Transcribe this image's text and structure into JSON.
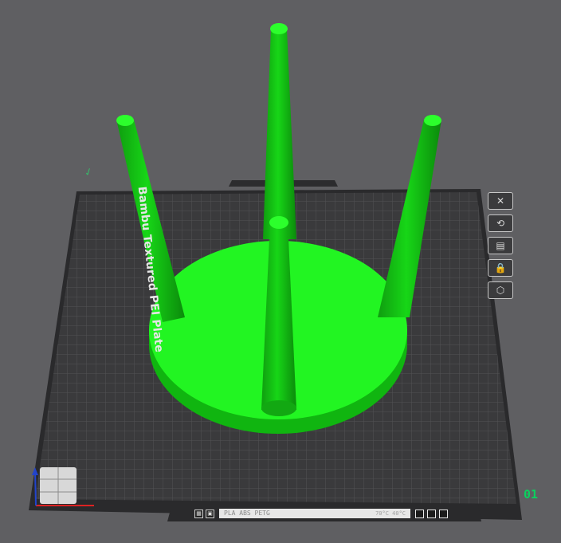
{
  "plate": {
    "name": "Bambu Textured PEI Plate",
    "number": "01",
    "filament": "PLA ABS PETG",
    "temps": "70°C  40°C"
  },
  "toolbar": {
    "icons": [
      "close-icon",
      "auto-orient-icon",
      "arrange-icon",
      "lock-icon",
      "settings-icon"
    ]
  },
  "colors": {
    "background": "#5f5f62",
    "plate": "#3a3a3c",
    "model": "#1cf01c",
    "accent": "#0bd15e"
  }
}
